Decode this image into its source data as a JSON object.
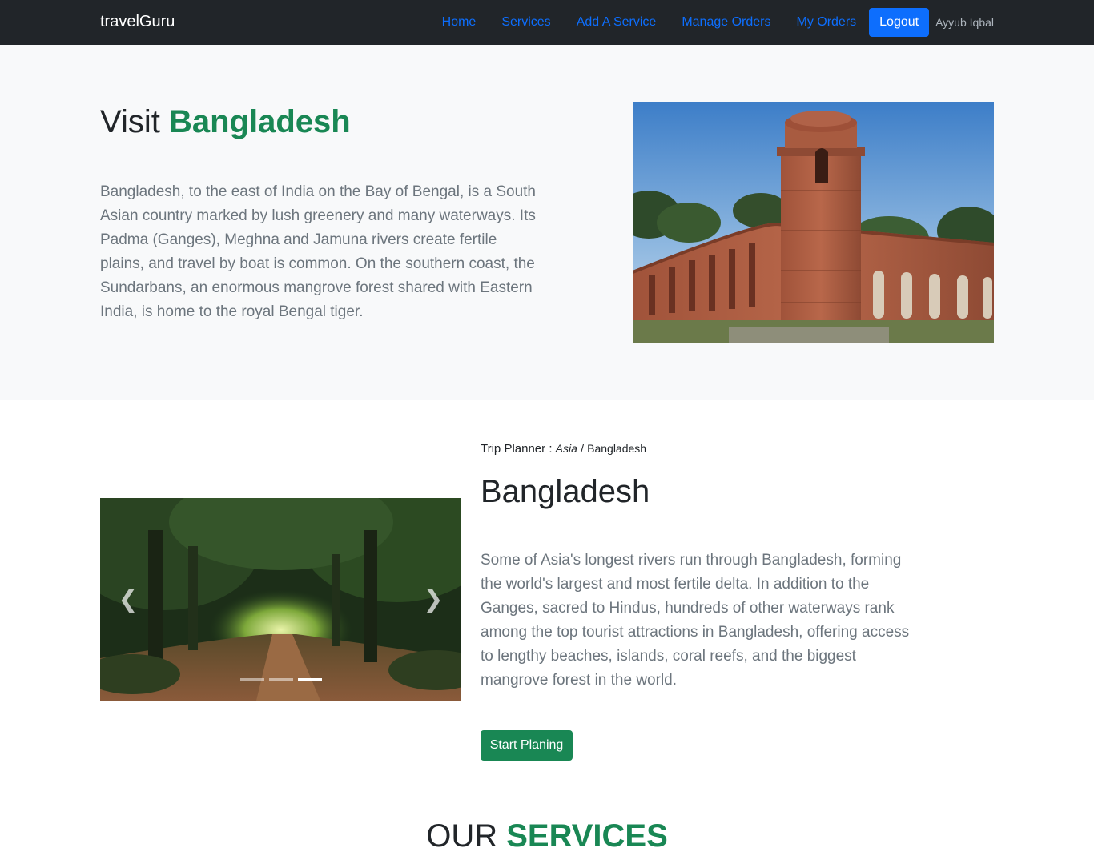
{
  "navbar": {
    "brand": "travelGuru",
    "links": [
      "Home",
      "Services",
      "Add A Service",
      "Manage Orders",
      "My Orders"
    ],
    "logout_label": "Logout",
    "user_name": "Ayyub Iqbal"
  },
  "hero": {
    "title_prefix": "Visit",
    "title_accent": "Bangladesh",
    "text": "Bangladesh, to the east of India on the Bay of Bengal, is a South Asian country marked by lush greenery and many waterways. Its Padma (Ganges), Meghna and Jamuna rivers create fertile plains, and travel by boat is common. On the southern coast, the Sundarbans, an enormous mangrove forest shared with Eastern India, is home to the royal Bengal tiger."
  },
  "planner": {
    "breadcrumb_label": "Trip Planner :",
    "breadcrumb_region": "Asia",
    "breadcrumb_sep": "/",
    "breadcrumb_country": "Bangladesh",
    "title": "Bangladesh",
    "text": "Some of Asia's longest rivers run through Bangladesh, forming the world's largest and most fertile delta. In addition to the Ganges, sacred to Hindus, hundreds of other waterways rank among the top tourist attractions in Bangladesh, offering access to lengthy beaches, islands, coral reefs, and the biggest mangrove forest in the world.",
    "button_label": "Start Planing",
    "carousel": {
      "prev_icon": "chevron-left-icon",
      "next_icon": "chevron-right-icon",
      "slide_count": 3,
      "active_slide": 3
    }
  },
  "services": {
    "title_prefix": "OUR",
    "title_accent": "SERVICES"
  },
  "colors": {
    "navbar_bg": "#212529",
    "link": "#0d6efd",
    "accent_green": "#198754",
    "hero_bg": "#f8f9fa",
    "muted_text": "#6c757d"
  }
}
